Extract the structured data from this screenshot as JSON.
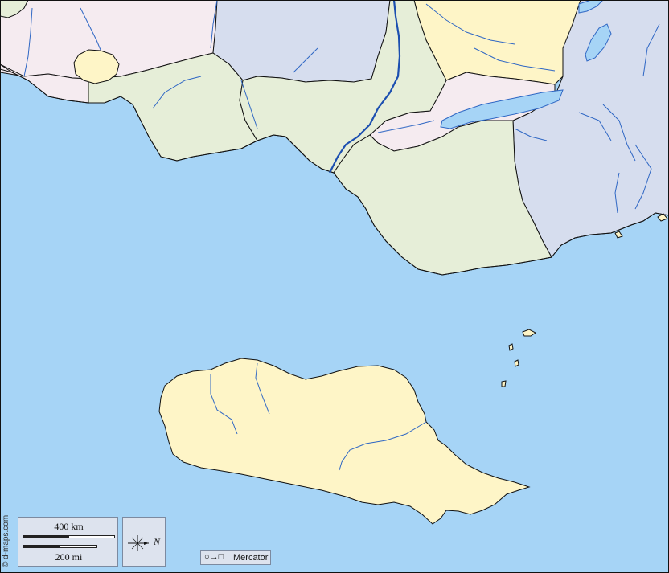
{
  "map": {
    "colors": {
      "sea": "#a6d4f6",
      "land_pink": "#f5ebf0",
      "land_blue": "#d6ddee",
      "land_green": "#e6eed8",
      "land_yellow": "#fef5c7",
      "river": "#2f67c4",
      "border": "#111111"
    },
    "scale": {
      "km_label": "400 km",
      "mi_label": "200 mi"
    },
    "north_label": "N",
    "projection_symbol": "○→□",
    "projection_label": "Mercator",
    "credit": "© d-maps.com"
  }
}
